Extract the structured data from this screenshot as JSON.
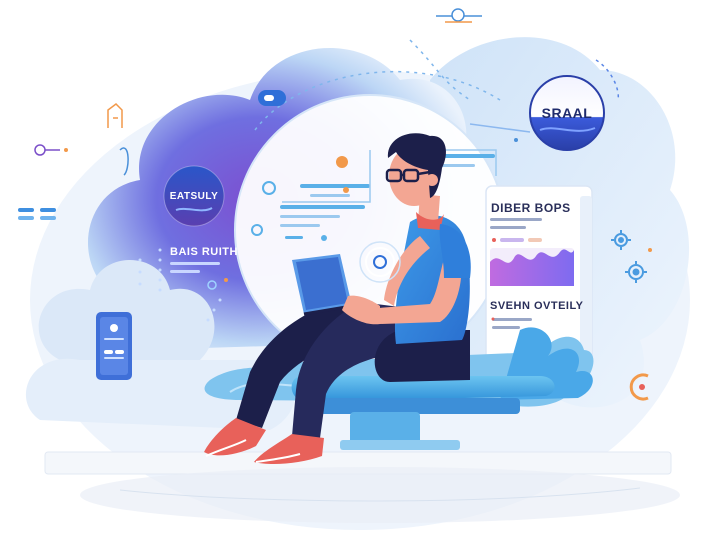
{
  "labels": {
    "badge_left": "EATSULY",
    "badge_right": "SRAAL",
    "left_panel_text": "BAIS RUITH",
    "card_title": "DIBER BOPS",
    "card_subtitle": "SVEHN OVTEILY"
  },
  "colors": {
    "primary_blue": "#3f8fe0",
    "purple": "#7b4fc9",
    "navy": "#1f2b6c",
    "accent_orange": "#f2994a",
    "shoe_red": "#e8615a",
    "skin": "#f3a693"
  },
  "icons": [
    "gear-icon",
    "link-icon",
    "toggle-icon"
  ]
}
